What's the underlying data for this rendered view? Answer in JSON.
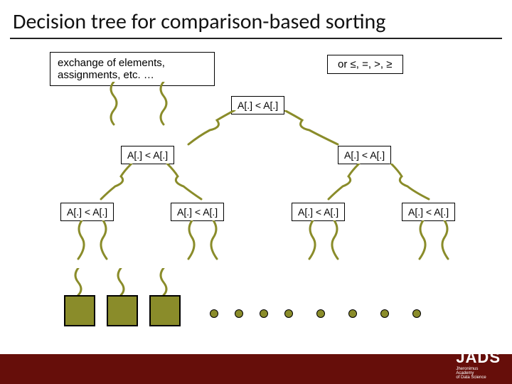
{
  "title": "Decision tree for comparison-based sorting",
  "callouts": {
    "exchange": "exchange of elements,\nassignments, etc. …",
    "comparators": "or ≤, =, >, ≥"
  },
  "nodes": {
    "root": "A[.] < A[.]",
    "l1l": "A[.] < A[.]",
    "l1r": "A[.] < A[.]",
    "l2a": "A[.] < A[.]",
    "l2b": "A[.] < A[.]",
    "l2c": "A[.] < A[.]",
    "l2d": "A[.] < A[.]"
  },
  "footer": {
    "logo": "JADS",
    "sub1": "Jheronimus",
    "sub2": "Academy",
    "sub3": "of Data Science"
  }
}
